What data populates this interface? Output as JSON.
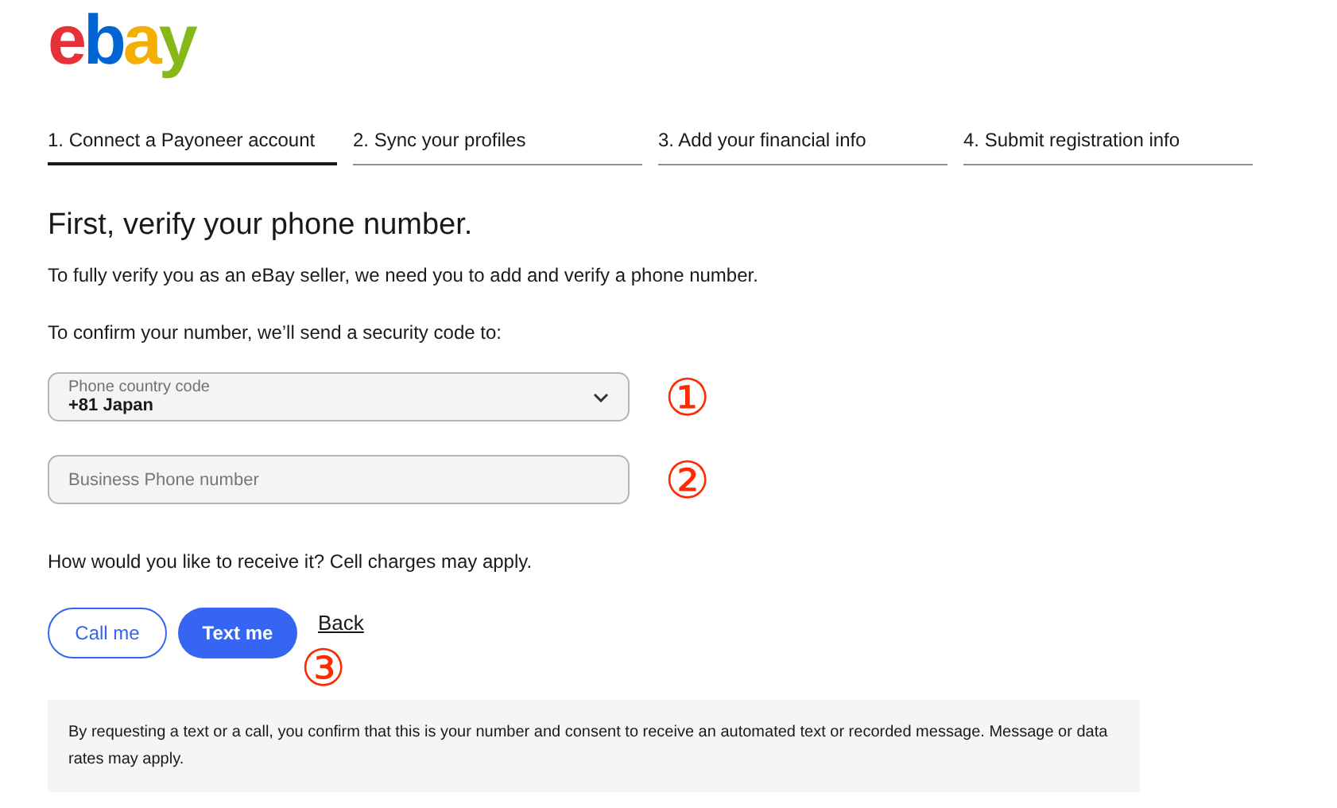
{
  "logo": "ebay",
  "steps": [
    {
      "label": "1. Connect a Payoneer account",
      "selected": true
    },
    {
      "label": "2. Sync your profiles",
      "selected": false
    },
    {
      "label": "3. Add your financial info",
      "selected": false
    },
    {
      "label": "4. Submit registration info",
      "selected": false
    }
  ],
  "heading": "First, verify your phone number.",
  "intro": "To fully verify you as an eBay seller, we need you to add and verify a phone number.",
  "confirm_text": "To confirm your number, we’ll send a security code to:",
  "country_select": {
    "label": "Phone country code",
    "value": "+81 Japan",
    "annotation": "①"
  },
  "phone_field": {
    "placeholder": "Business Phone number",
    "annotation": "②"
  },
  "receive_text": "How would you like to receive it? Cell charges may apply.",
  "buttons": [
    {
      "label": "Call me",
      "kind": "secondary"
    },
    {
      "label": "Text me",
      "kind": "primary"
    },
    {
      "label": "Back",
      "kind": "link"
    }
  ],
  "buttons_annotation": "③",
  "notice": "By requesting a text or a call, you confirm that this is your number and consent to receive an automated text or recorded message. Message or data rates may apply."
}
